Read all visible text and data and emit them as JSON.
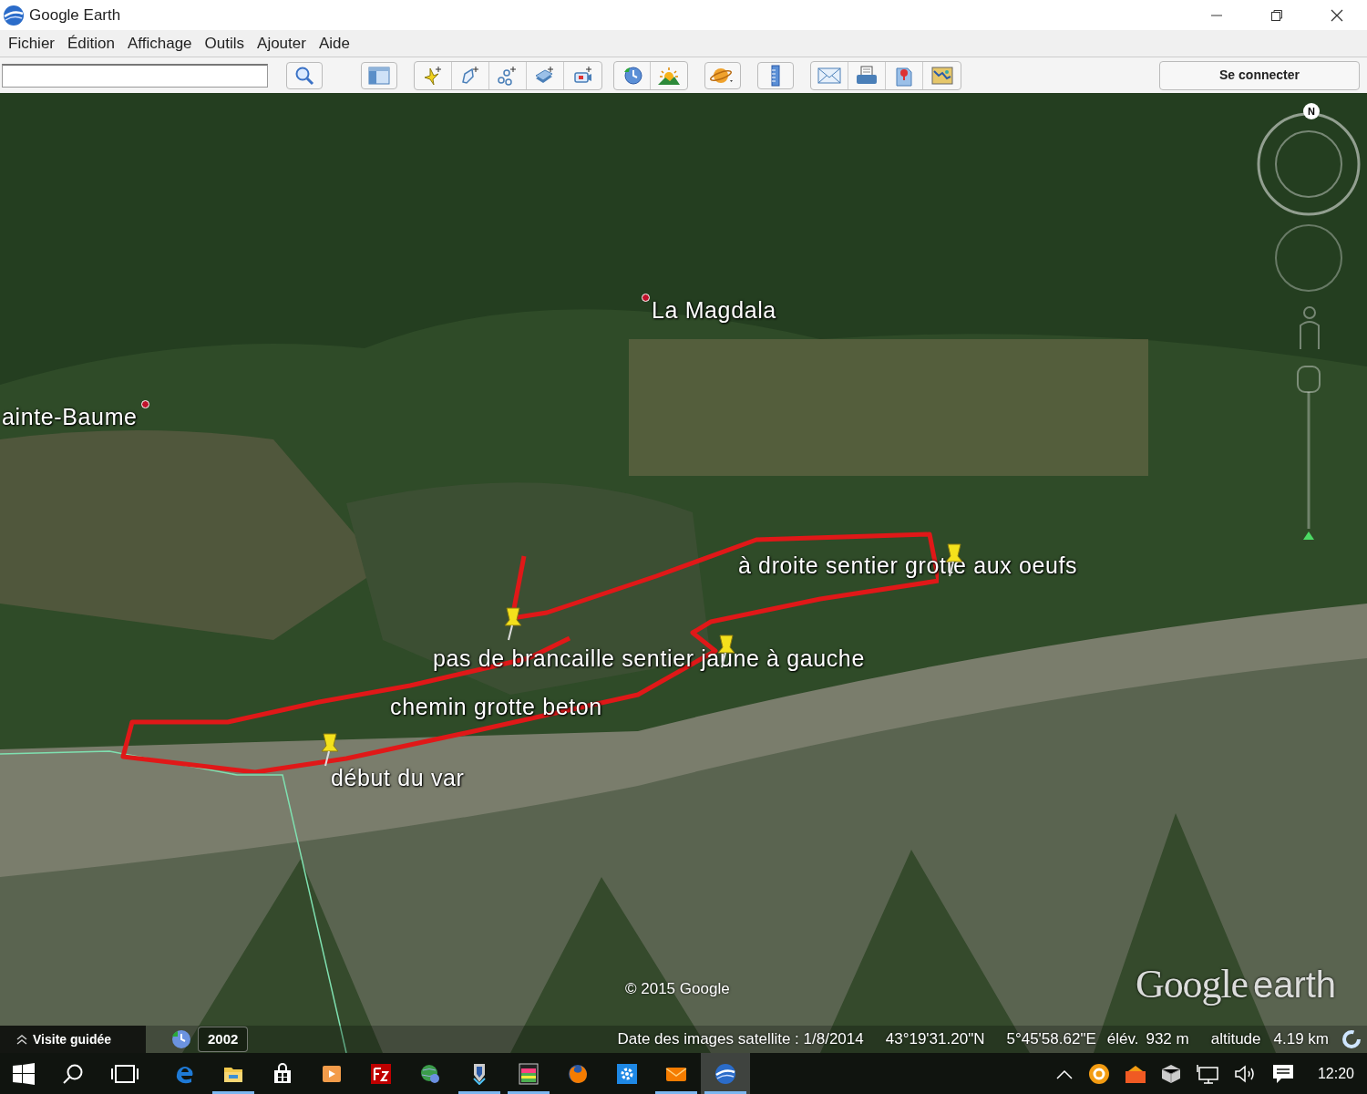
{
  "window": {
    "title": "Google Earth"
  },
  "menu": [
    {
      "label": "Fichier"
    },
    {
      "label": "Édition"
    },
    {
      "label": "Affichage"
    },
    {
      "label": "Outils"
    },
    {
      "label": "Ajouter"
    },
    {
      "label": "Aide"
    }
  ],
  "toolbar": {
    "sign_in": "Se connecter"
  },
  "map": {
    "labels": [
      {
        "text": "La Magdala",
        "kind": "place"
      },
      {
        "text": "ainte-Baume",
        "kind": "place"
      },
      {
        "text": "à droite sentier grotte aux oeufs",
        "kind": "track"
      },
      {
        "text": "pas de brancaille sentier jaune à gauche",
        "kind": "track"
      },
      {
        "text": "chemin grotte beton",
        "kind": "track"
      },
      {
        "text": "début du var",
        "kind": "track"
      }
    ],
    "compass": "N",
    "copyright": "© 2015 Google",
    "logo": {
      "brand": "Google",
      "product": "earth"
    }
  },
  "status_bar": {
    "tour": "Visite guidée",
    "year": "2002",
    "imagery_date": "Date des images satellite : 1/8/2014",
    "latitude": "43°19'31.20\"N",
    "longitude": "5°45'58.62\"E",
    "elevation_label": "élév.",
    "elevation": "932 m",
    "altitude_label": "altitude",
    "altitude": "4.19 km"
  },
  "taskbar": {
    "apps": [
      {
        "kind": "edge",
        "running": false,
        "active": false
      },
      {
        "kind": "folder",
        "running": true,
        "active": false
      },
      {
        "kind": "store",
        "running": false,
        "active": false
      },
      {
        "kind": "media",
        "running": false,
        "active": false
      },
      {
        "kind": "filezilla",
        "running": false,
        "active": false
      },
      {
        "kind": "globe",
        "running": false,
        "active": false
      },
      {
        "kind": "shield",
        "running": true,
        "active": false
      },
      {
        "kind": "image",
        "running": true,
        "active": false
      },
      {
        "kind": "firefox",
        "running": false,
        "active": false
      },
      {
        "kind": "gear",
        "running": false,
        "active": false
      },
      {
        "kind": "mail",
        "running": true,
        "active": false
      },
      {
        "kind": "earth",
        "running": true,
        "active": true
      }
    ],
    "clock": "12:20"
  }
}
